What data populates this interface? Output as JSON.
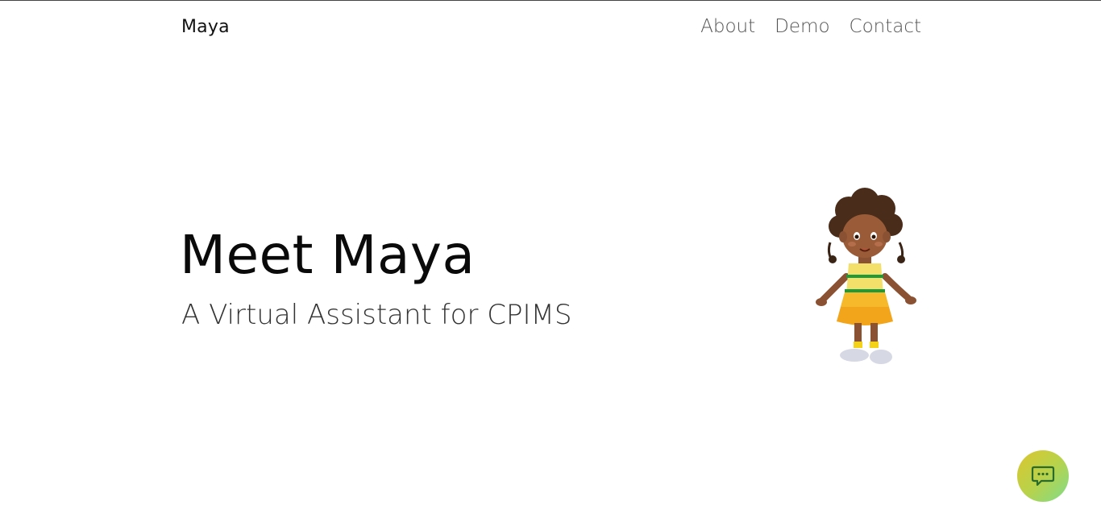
{
  "navbar": {
    "brand": "Maya",
    "links": [
      {
        "label": "About"
      },
      {
        "label": "Demo"
      },
      {
        "label": "Contact"
      }
    ]
  },
  "hero": {
    "title": "Meet Maya",
    "subtitle": "A Virtual Assistant for CPIMS"
  },
  "illustration": {
    "icon": "maya-girl-illustration"
  },
  "chat": {
    "icon": "chat-bubble-icon",
    "colors": [
      "#dcc62f",
      "#7fdc8a"
    ],
    "icon_color": "#2a6a2a"
  }
}
